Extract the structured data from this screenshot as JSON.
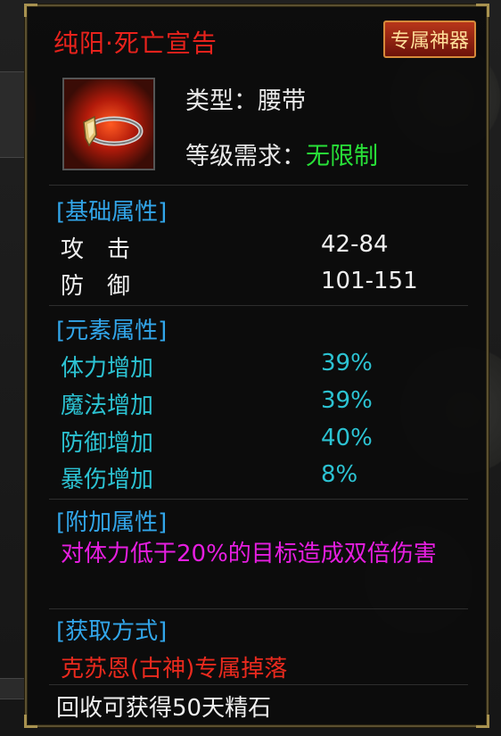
{
  "item": {
    "name": "纯阳·死亡宣告",
    "badge": "专属神器",
    "type_label": "类型：",
    "type_value": "腰带",
    "level_label": "等级需求：",
    "level_value": "无限制"
  },
  "sections": {
    "basic": {
      "title": "[基础属性]",
      "rows": [
        {
          "label": "攻　击",
          "value": "42-84"
        },
        {
          "label": "防　御",
          "value": "101-151"
        }
      ]
    },
    "element": {
      "title": "[元素属性]",
      "rows": [
        {
          "label": "体力增加",
          "value": "39%"
        },
        {
          "label": "魔法增加",
          "value": "39%"
        },
        {
          "label": "防御增加",
          "value": "40%"
        },
        {
          "label": "暴伤增加",
          "value": "8%"
        }
      ]
    },
    "extra": {
      "title": "[附加属性]",
      "text": "对体力低于20%的目标造成双倍伤害"
    },
    "source": {
      "title": "[获取方式]",
      "text": "克苏恩(古神)专属掉落"
    }
  },
  "footer": "回收可获得50天精石",
  "colors": {
    "title": "#e8221c",
    "section": "#32a6ea",
    "element_stat": "#2cc3d3",
    "extra_text": "#e61ee0",
    "source_text": "#ea2a1e",
    "unlimited": "#28e038"
  },
  "icon": {
    "name": "belt-icon"
  }
}
